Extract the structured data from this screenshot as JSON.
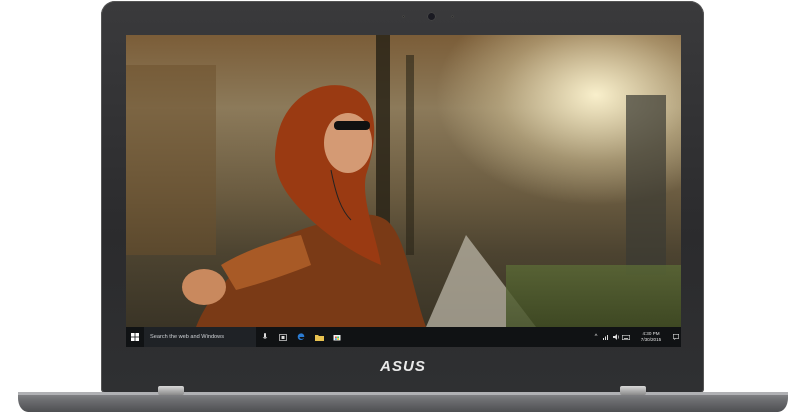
{
  "device": {
    "brand_logo_text": "ASUS"
  },
  "taskbar": {
    "start_icon": "windows-logo-icon",
    "search_placeholder": "Search the web and Windows",
    "pinned_icons": [
      "microphone-icon",
      "task-view-icon",
      "edge-icon",
      "file-explorer-icon",
      "store-icon"
    ],
    "tray_icons": [
      "chevron-up-icon",
      "network-icon",
      "speaker-icon",
      "keyboard-icon"
    ],
    "clock_time": "4:30 PM",
    "clock_date": "7/30/2015"
  },
  "colors": {
    "taskbar_bg": "#101214",
    "search_bg": "#1f2226",
    "bezel": "#2b2b2d",
    "edge_blue": "#2b7cd3",
    "folder_yellow": "#e8c250"
  }
}
